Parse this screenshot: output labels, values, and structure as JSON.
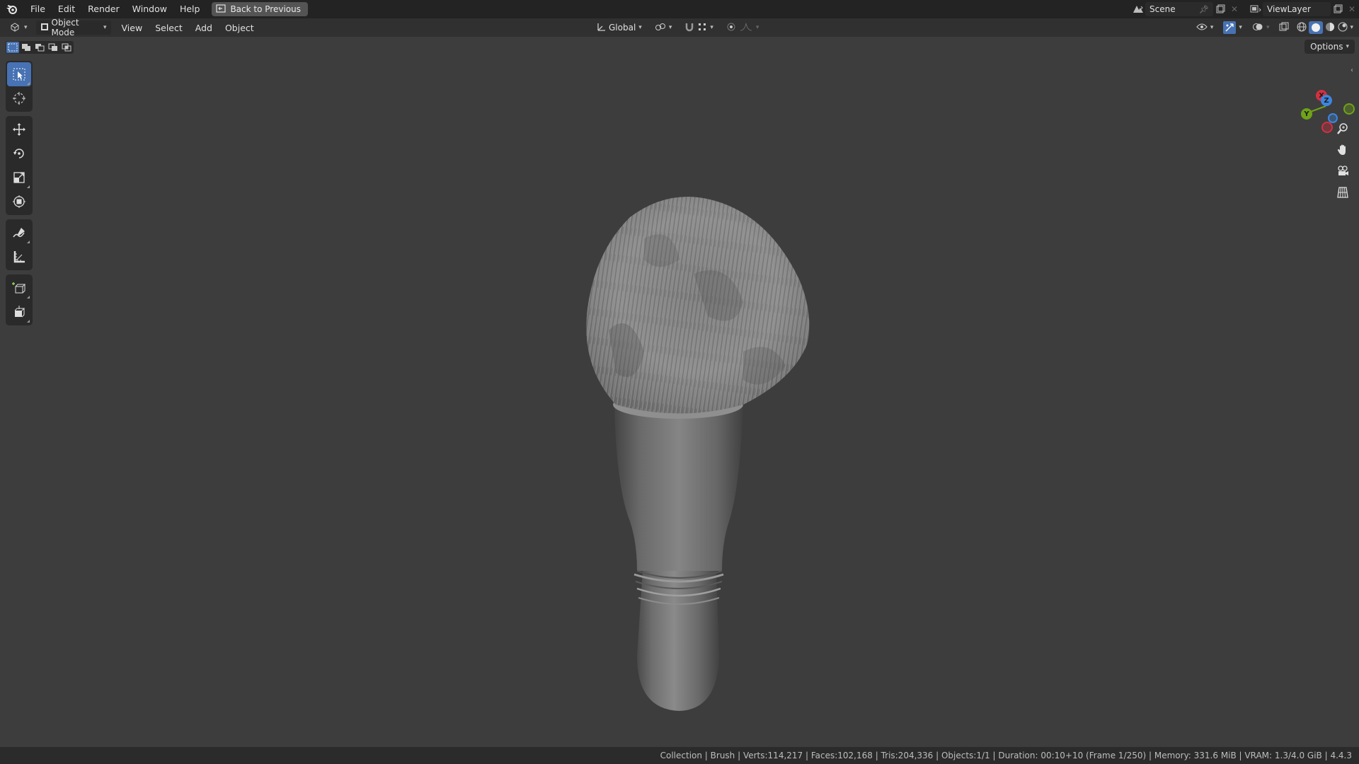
{
  "topbar": {
    "menus": [
      "File",
      "Edit",
      "Render",
      "Window",
      "Help"
    ],
    "back_label": "Back to Previous",
    "scene_name": "Scene",
    "view_layer_name": "ViewLayer"
  },
  "viewport_header": {
    "mode_label": "Object Mode",
    "menus": [
      "View",
      "Select",
      "Add",
      "Object"
    ],
    "transform_orientation": "Global",
    "options_label": "Options"
  },
  "gizmo": {
    "x_label": "X",
    "y_label": "Y",
    "z_label": "Z",
    "x_color": "#d5303f",
    "y_color": "#6fa318",
    "z_color": "#3d86e0"
  },
  "accent_color": "#4772b3",
  "statusbar": {
    "text": "Collection | Brush | Verts:114,217 | Faces:102,168 | Tris:204,336 | Objects:1/1 | Duration: 00:10+10 (Frame 1/250) | Memory: 331.6 MiB | VRAM: 1.3/4.0 GiB | 4.4.3"
  }
}
